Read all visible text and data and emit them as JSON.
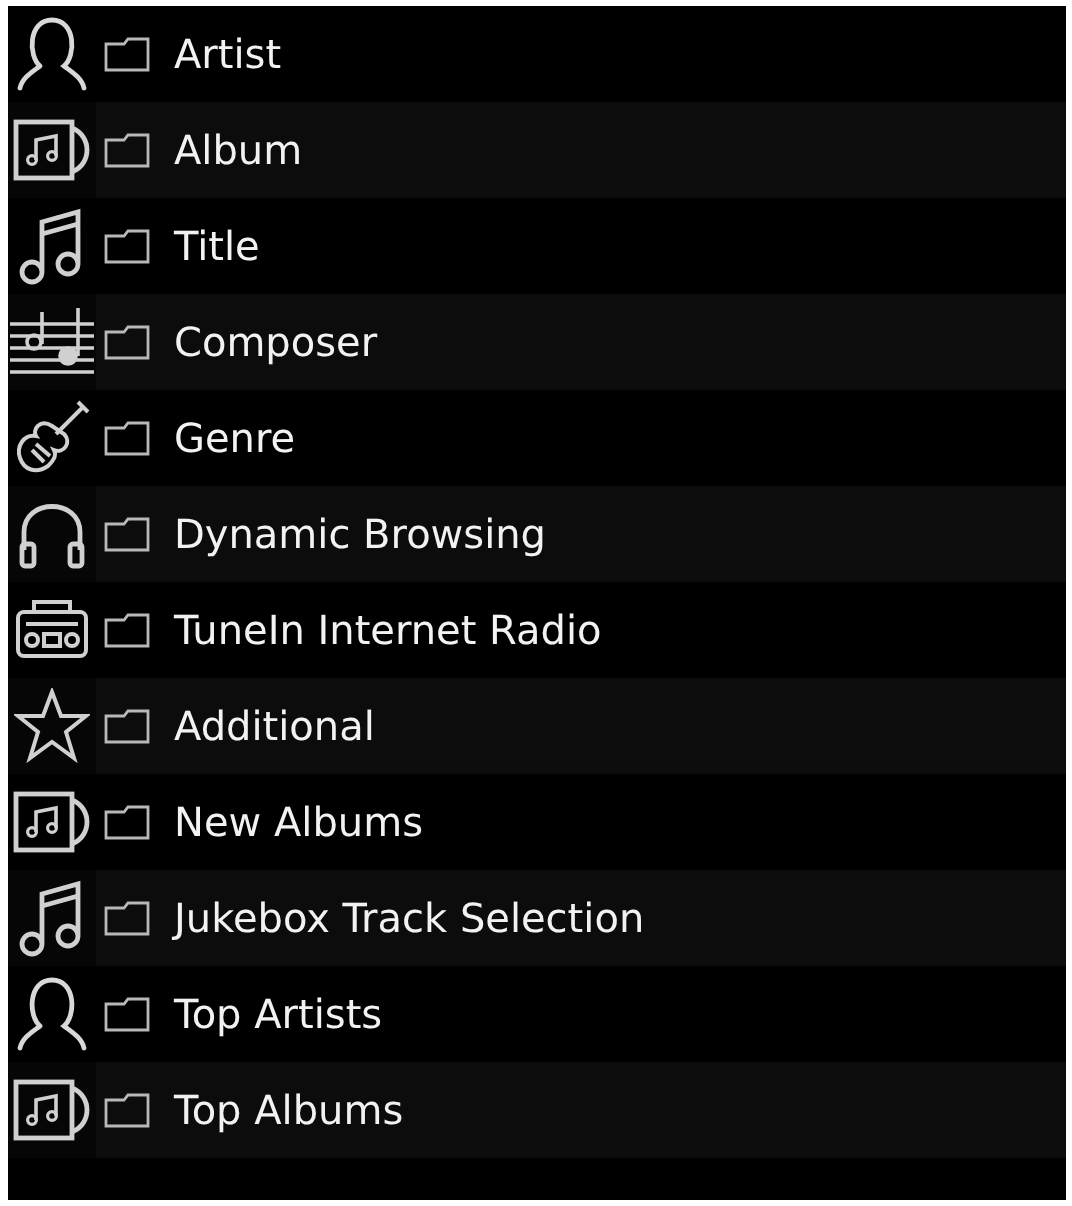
{
  "items": [
    {
      "kind": "person",
      "label": "Artist"
    },
    {
      "kind": "album",
      "label": "Album"
    },
    {
      "kind": "note",
      "label": "Title"
    },
    {
      "kind": "staff",
      "label": "Composer"
    },
    {
      "kind": "guitar",
      "label": "Genre"
    },
    {
      "kind": "headphones",
      "label": "Dynamic Browsing"
    },
    {
      "kind": "radio",
      "label": "TuneIn Internet Radio"
    },
    {
      "kind": "star",
      "label": "Additional"
    },
    {
      "kind": "album",
      "label": "New Albums"
    },
    {
      "kind": "note",
      "label": "Jukebox Track Selection"
    },
    {
      "kind": "person",
      "label": "Top Artists"
    },
    {
      "kind": "album",
      "label": "Top Albums"
    }
  ]
}
